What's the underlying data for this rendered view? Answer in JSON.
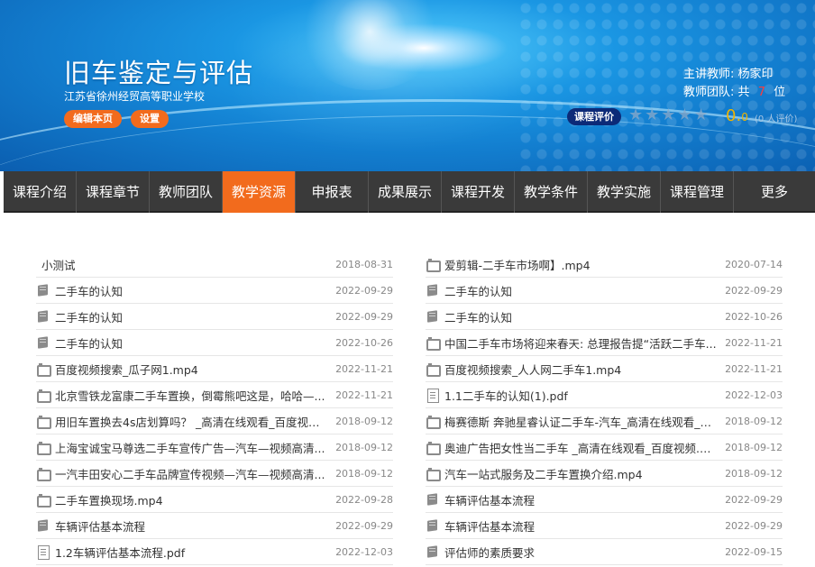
{
  "course": {
    "title": "旧车鉴定与评估",
    "school": "江苏省徐州经贸高等职业学校",
    "edit_label": "编辑本页",
    "settings_label": "设置"
  },
  "teacher": {
    "lead_label": "主讲教师:",
    "lead_name": "杨家印",
    "team_label": "教师团队:",
    "team_prefix": "共",
    "team_count": "7",
    "team_suffix": "位"
  },
  "rating": {
    "label": "课程评价",
    "stars": "★★★★★",
    "score": "0.",
    "score_decimal": "0",
    "raters": "(0 人评价)"
  },
  "nav": {
    "items": [
      {
        "label": "课程介绍"
      },
      {
        "label": "课程章节"
      },
      {
        "label": "教师团队"
      },
      {
        "label": "教学资源"
      },
      {
        "label": "申报表"
      },
      {
        "label": "成果展示"
      },
      {
        "label": "课程开发"
      },
      {
        "label": "教学条件"
      },
      {
        "label": "教学实施"
      },
      {
        "label": "课程管理"
      },
      {
        "label": "更多"
      }
    ],
    "active_index": 3
  },
  "resources_left": [
    {
      "icon": "none",
      "title": "小测试",
      "date": "2018-08-31"
    },
    {
      "icon": "book",
      "title": "二手车的认知",
      "date": "2022-09-29"
    },
    {
      "icon": "book",
      "title": "二手车的认知",
      "date": "2022-09-29"
    },
    {
      "icon": "book",
      "title": "二手车的认知",
      "date": "2022-10-26"
    },
    {
      "icon": "video",
      "title": "百度视频搜索_瓜子网1.mp4",
      "date": "2022-11-21"
    },
    {
      "icon": "video",
      "title": "北京雪铁龙富康二手车置换，倒霉熊吧这是，哈哈—...",
      "date": "2022-11-21"
    },
    {
      "icon": "video",
      "title": "用旧车置换去4s店划算吗？ _高清在线观看_百度视频...",
      "date": "2018-09-12"
    },
    {
      "icon": "video",
      "title": "上海宝诚宝马尊选二手车宣传广告—汽车—视频高清...",
      "date": "2018-09-12"
    },
    {
      "icon": "video",
      "title": "一汽丰田安心二手车品牌宣传视频—汽车—视频高清...",
      "date": "2018-09-12"
    },
    {
      "icon": "video",
      "title": "二手车置换现场.mp4",
      "date": "2022-09-28"
    },
    {
      "icon": "book",
      "title": "车辆评估基本流程",
      "date": "2022-09-29"
    },
    {
      "icon": "doc",
      "title": "1.2车辆评估基本流程.pdf",
      "date": "2022-12-03"
    }
  ],
  "resources_right": [
    {
      "icon": "video",
      "title": "爱剪辑-二手车市场啊】.mp4",
      "date": "2020-07-14"
    },
    {
      "icon": "book",
      "title": "二手车的认知",
      "date": "2022-09-29"
    },
    {
      "icon": "book",
      "title": "二手车的认知",
      "date": "2022-10-26"
    },
    {
      "icon": "video",
      "title": "中国二手车市场将迎来春天: 总理报告提“活跃二手车...",
      "date": "2022-11-21"
    },
    {
      "icon": "video",
      "title": "百度视频搜索_人人网二手车1.mp4",
      "date": "2022-11-21"
    },
    {
      "icon": "doc",
      "title": "1.1二手车的认知(1).pdf",
      "date": "2022-12-03"
    },
    {
      "icon": "video",
      "title": "梅赛德斯 奔驰星睿认证二手车-汽车_高清在线观看_百...",
      "date": "2018-09-12"
    },
    {
      "icon": "video",
      "title": "奥迪广告把女性当二手车 _高清在线观看_百度视频.mp4",
      "date": "2018-09-12"
    },
    {
      "icon": "video",
      "title": "汽车一站式服务及二手车置换介绍.mp4",
      "date": "2018-09-12"
    },
    {
      "icon": "book",
      "title": "车辆评估基本流程",
      "date": "2022-09-29"
    },
    {
      "icon": "book",
      "title": "车辆评估基本流程",
      "date": "2022-09-29"
    },
    {
      "icon": "book",
      "title": "评估师的素质要求",
      "date": "2022-09-15"
    }
  ]
}
